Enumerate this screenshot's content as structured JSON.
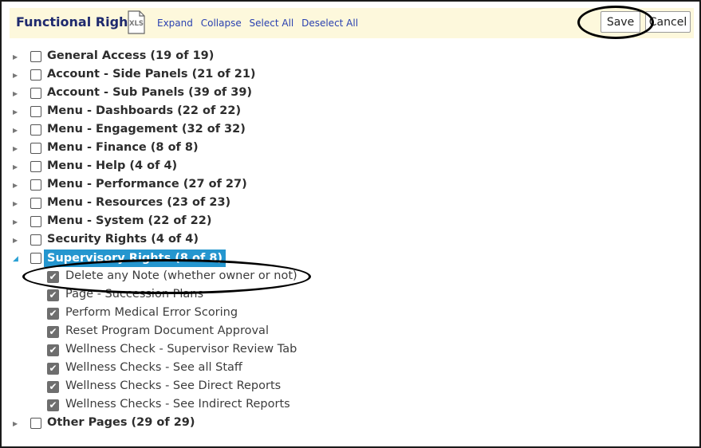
{
  "header": {
    "title": "Functional Rights",
    "xls_icon_text": "XLS",
    "links": {
      "expand": "Expand",
      "collapse": "Collapse",
      "select_all": "Select All",
      "deselect_all": "Deselect All"
    },
    "save_label": "Save",
    "cancel_label": "Cancel"
  },
  "groups": [
    {
      "label": "General Access (19 of 19)"
    },
    {
      "label": "Account - Side Panels (21 of 21)"
    },
    {
      "label": "Account - Sub Panels (39 of 39)"
    },
    {
      "label": "Menu - Dashboards (22 of 22)"
    },
    {
      "label": "Menu - Engagement (32 of 32)"
    },
    {
      "label": "Menu - Finance (8 of 8)"
    },
    {
      "label": "Menu - Help (4 of 4)"
    },
    {
      "label": "Menu - Performance (27 of 27)"
    },
    {
      "label": "Menu - Resources (23 of 23)"
    },
    {
      "label": "Menu - System (22 of 22)"
    },
    {
      "label": "Security Rights (4 of 4)"
    },
    {
      "label": "Supervisory Rights (8 of 8)",
      "expanded": true,
      "selected": true
    },
    {
      "label": "Other Pages (29 of 29)"
    }
  ],
  "supervisory_items": [
    {
      "label": "Delete any Note (whether owner or not)",
      "checked": true
    },
    {
      "label": "Page - Succession Plans",
      "checked": true
    },
    {
      "label": "Perform Medical Error Scoring",
      "checked": true
    },
    {
      "label": "Reset Program Document Approval",
      "checked": true
    },
    {
      "label": "Wellness Check - Supervisor Review Tab",
      "checked": true
    },
    {
      "label": "Wellness Checks - See all Staff",
      "checked": true
    },
    {
      "label": "Wellness Checks - See Direct Reports",
      "checked": true
    },
    {
      "label": "Wellness Checks - See Indirect Reports",
      "checked": true
    }
  ],
  "colors": {
    "title": "#1f2a6e",
    "link": "#2a41b0",
    "selected_bg": "#2596cf",
    "header_bg": "#fdf8dc"
  },
  "icons": {
    "collapsed": "triangle-right-icon",
    "expanded": "triangle-down-icon"
  }
}
